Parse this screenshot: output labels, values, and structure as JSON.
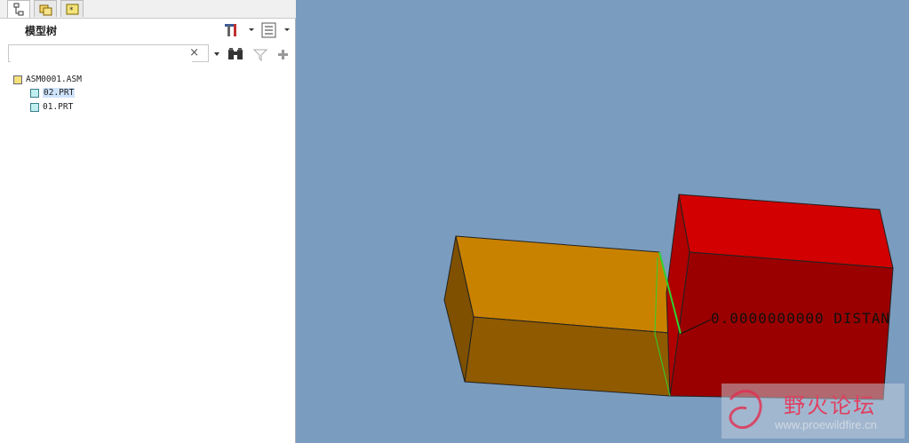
{
  "panel": {
    "title": "模型树",
    "tabs": [
      {
        "icon": "model-tree-tab-icon"
      },
      {
        "icon": "folder-browser-tab-icon"
      },
      {
        "icon": "favorites-tab-icon"
      }
    ],
    "search": {
      "value": "",
      "placeholder": "",
      "clear_glyph": "×"
    }
  },
  "tree": {
    "items": [
      {
        "label": "ASM0001.ASM",
        "type": "assembly",
        "selected": false
      },
      {
        "label": "02.PRT",
        "type": "part",
        "selected": true
      },
      {
        "label": "01.PRT",
        "type": "part",
        "selected": false
      }
    ]
  },
  "viewport": {
    "dimension_text": "0.0000000000  DISTAN",
    "watermark": {
      "name": "野火论坛",
      "url": "www.proewildfire.cn"
    }
  },
  "colors": {
    "viewport_bg": "#7a9cbf",
    "part_orange": "#c98200",
    "part_red": "#d20000",
    "constraint_green": "#2fd12f"
  }
}
